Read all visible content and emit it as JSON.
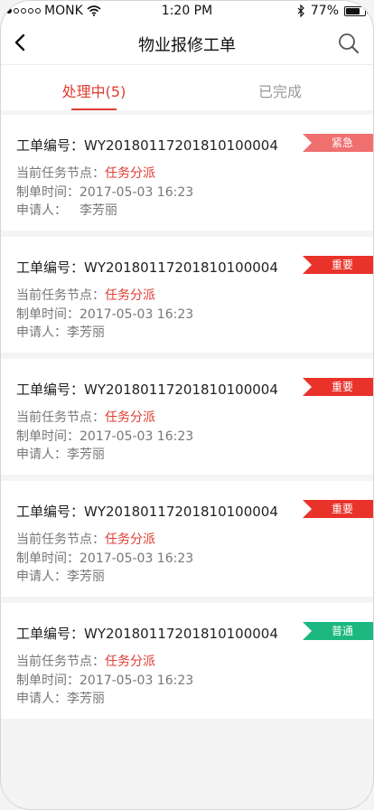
{
  "status_bar": {
    "carrier": "MONK",
    "time": "1:20 PM",
    "battery_percent": "77%",
    "battery_level": 0.77
  },
  "nav": {
    "title": "物业报修工单",
    "icons": {
      "back": "chevron-left-icon",
      "search": "search-icon"
    }
  },
  "tabs": [
    {
      "label": "处理中(5)",
      "active": true
    },
    {
      "label": "已完成",
      "active": false
    }
  ],
  "labels": {
    "order_no": "工单编号：",
    "task_node": "当前任务节点：",
    "created_time": "制单时间：",
    "applicant": "申请人："
  },
  "colors": {
    "accent": "#e03c31",
    "urgent": "#f07070",
    "important": "#e8322a",
    "normal": "#1db881"
  },
  "orders": [
    {
      "order_no": "WY20180117201810100004",
      "task_node": "任务分派",
      "created_time": "2017-05-03 16:23",
      "applicant": "李芳丽",
      "priority": "紧急",
      "priority_color": "#f07070"
    },
    {
      "order_no": "WY20180117201810100004",
      "task_node": "任务分派",
      "created_time": "2017-05-03 16:23",
      "applicant": "李芳丽",
      "priority": "重要",
      "priority_color": "#e8322a"
    },
    {
      "order_no": "WY20180117201810100004",
      "task_node": "任务分派",
      "created_time": "2017-05-03 16:23",
      "applicant": "李芳丽",
      "priority": "重要",
      "priority_color": "#e8322a"
    },
    {
      "order_no": "WY20180117201810100004",
      "task_node": "任务分派",
      "created_time": "2017-05-03 16:23",
      "applicant": "李芳丽",
      "priority": "重要",
      "priority_color": "#e8322a"
    },
    {
      "order_no": "WY20180117201810100004",
      "task_node": "任务分派",
      "created_time": "2017-05-03 16:23",
      "applicant": "李芳丽",
      "priority": "普通",
      "priority_color": "#1db881"
    }
  ]
}
